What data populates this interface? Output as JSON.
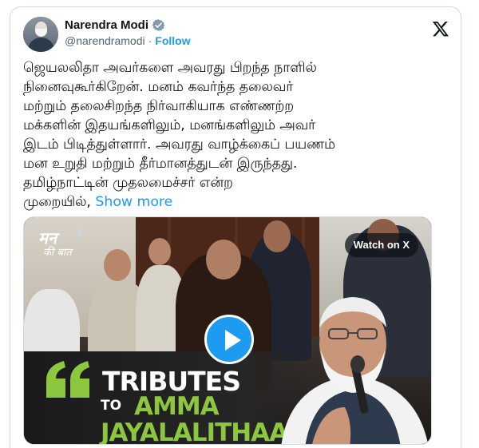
{
  "author": {
    "name": "Narendra Modi",
    "handle": "@narendramodi",
    "follow_label": "Follow",
    "separator": "·",
    "verified": true
  },
  "tweet": {
    "lines": [
      "ஜெயலலிதா அவர்களை அவரது  பிறந்த நாளில்",
      "நினைவுகூர்கிறேன். மனம் கவர்ந்த தலைவர்",
      "மற்றும் தலைசிறந்த நிர்வாகியாக எண்ணற்ற",
      "மக்களின் இதயங்களிலும், மனங்களிலும் அவர்",
      "இடம் பிடித்துள்ளார். அவரது வாழ்க்கைப் பயணம்",
      "மன உறுதி மற்றும் தீர்மானத்துடன் இருந்தது.",
      "தமிழ்நாட்டின் முதலமைச்சர் என்ற"
    ],
    "last_line": "முறையில்,",
    "show_more": "Show more"
  },
  "media": {
    "watch_label": "Watch on X",
    "logo_line1": "मन",
    "logo_line2": "की बात",
    "title_line1": "TRIBUTES",
    "title_to": "TO",
    "title_line2": "AMMA",
    "title_line3": "JAYALALITHAA JI"
  },
  "colors": {
    "accent": "#1d9bf0",
    "highlight_green": "#8dc63f",
    "text": "#0f1419",
    "muted": "#536471"
  },
  "icons": [
    "verified-badge-icon",
    "x-logo-icon",
    "play-icon",
    "quote-icon"
  ]
}
